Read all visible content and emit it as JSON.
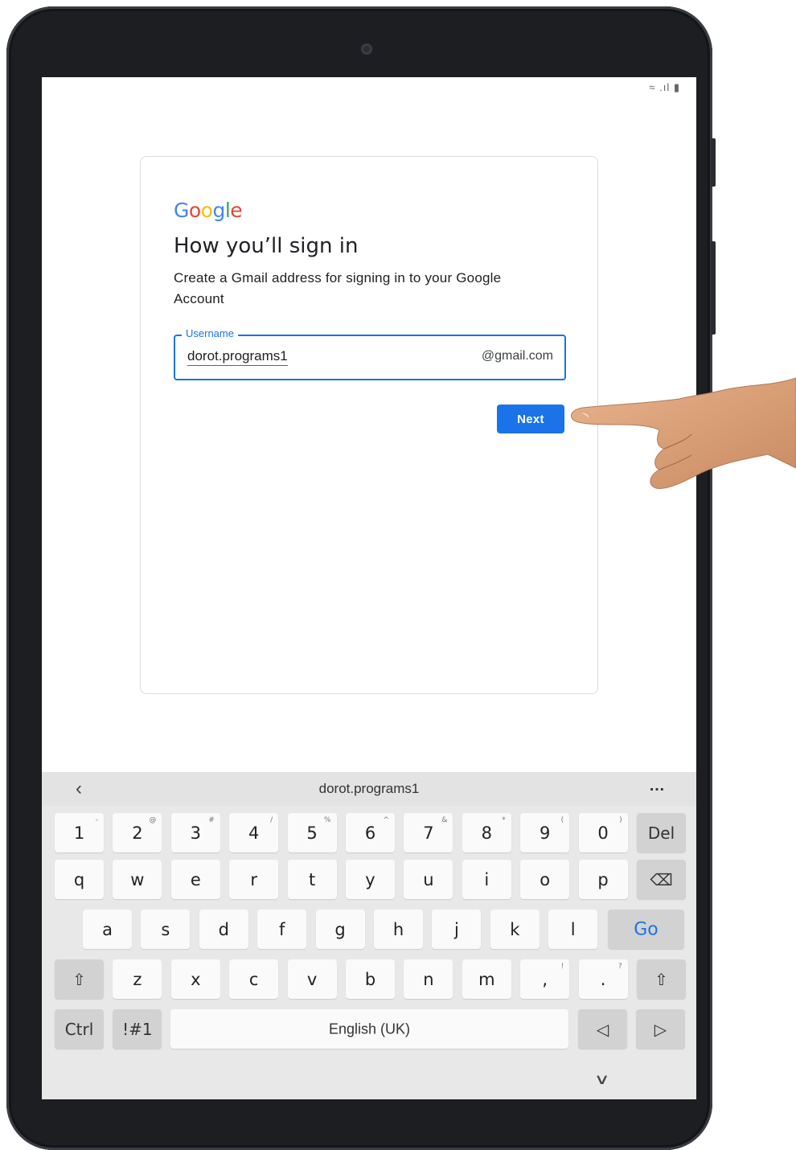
{
  "status_bar": {
    "icons_text": "≈ .ıl ▮"
  },
  "logo": {
    "letters": [
      {
        "ch": "G",
        "color": "#4285F4"
      },
      {
        "ch": "o",
        "color": "#EA4335"
      },
      {
        "ch": "o",
        "color": "#FBBC05"
      },
      {
        "ch": "g",
        "color": "#4285F4"
      },
      {
        "ch": "l",
        "color": "#34A853"
      },
      {
        "ch": "e",
        "color": "#EA4335"
      }
    ]
  },
  "page": {
    "title": "How you’ll sign in",
    "subtitle": "Create a Gmail address for signing in to your Google Account"
  },
  "username_field": {
    "label": "Username",
    "value": "dorot.programs1",
    "suffix": "@gmail.com"
  },
  "next_button": {
    "label": "Next"
  },
  "keyboard": {
    "suggestion": "dorot.programs1",
    "back_glyph": "‹",
    "more_glyph": "…",
    "number_row": [
      {
        "main": "1",
        "hint": "-"
      },
      {
        "main": "2",
        "hint": "@"
      },
      {
        "main": "3",
        "hint": "#"
      },
      {
        "main": "4",
        "hint": "/"
      },
      {
        "main": "5",
        "hint": "%"
      },
      {
        "main": "6",
        "hint": "^"
      },
      {
        "main": "7",
        "hint": "&"
      },
      {
        "main": "8",
        "hint": "*"
      },
      {
        "main": "9",
        "hint": "("
      },
      {
        "main": "0",
        "hint": ")"
      }
    ],
    "del_label": "Del",
    "row1": [
      "q",
      "w",
      "e",
      "r",
      "t",
      "y",
      "u",
      "i",
      "o",
      "p"
    ],
    "backspace_glyph": "⌫",
    "row2": [
      "a",
      "s",
      "d",
      "f",
      "g",
      "h",
      "j",
      "k",
      "l"
    ],
    "go_label": "Go",
    "shift_glyph": "⇧",
    "row3": [
      "z",
      "x",
      "c",
      "v",
      "b",
      "n",
      "m"
    ],
    "comma_key": {
      "main": ",",
      "hint": "!"
    },
    "period_key": {
      "main": ".",
      "hint": "?"
    },
    "ctrl_label": "Ctrl",
    "symbols_label": "!#1",
    "space_label": "English (UK)",
    "left_arrow_glyph": "◁",
    "right_arrow_glyph": "▷",
    "collapse_glyph": "∨"
  },
  "colors": {
    "accent": "#1a73e8",
    "frame": "#1d1e22"
  }
}
